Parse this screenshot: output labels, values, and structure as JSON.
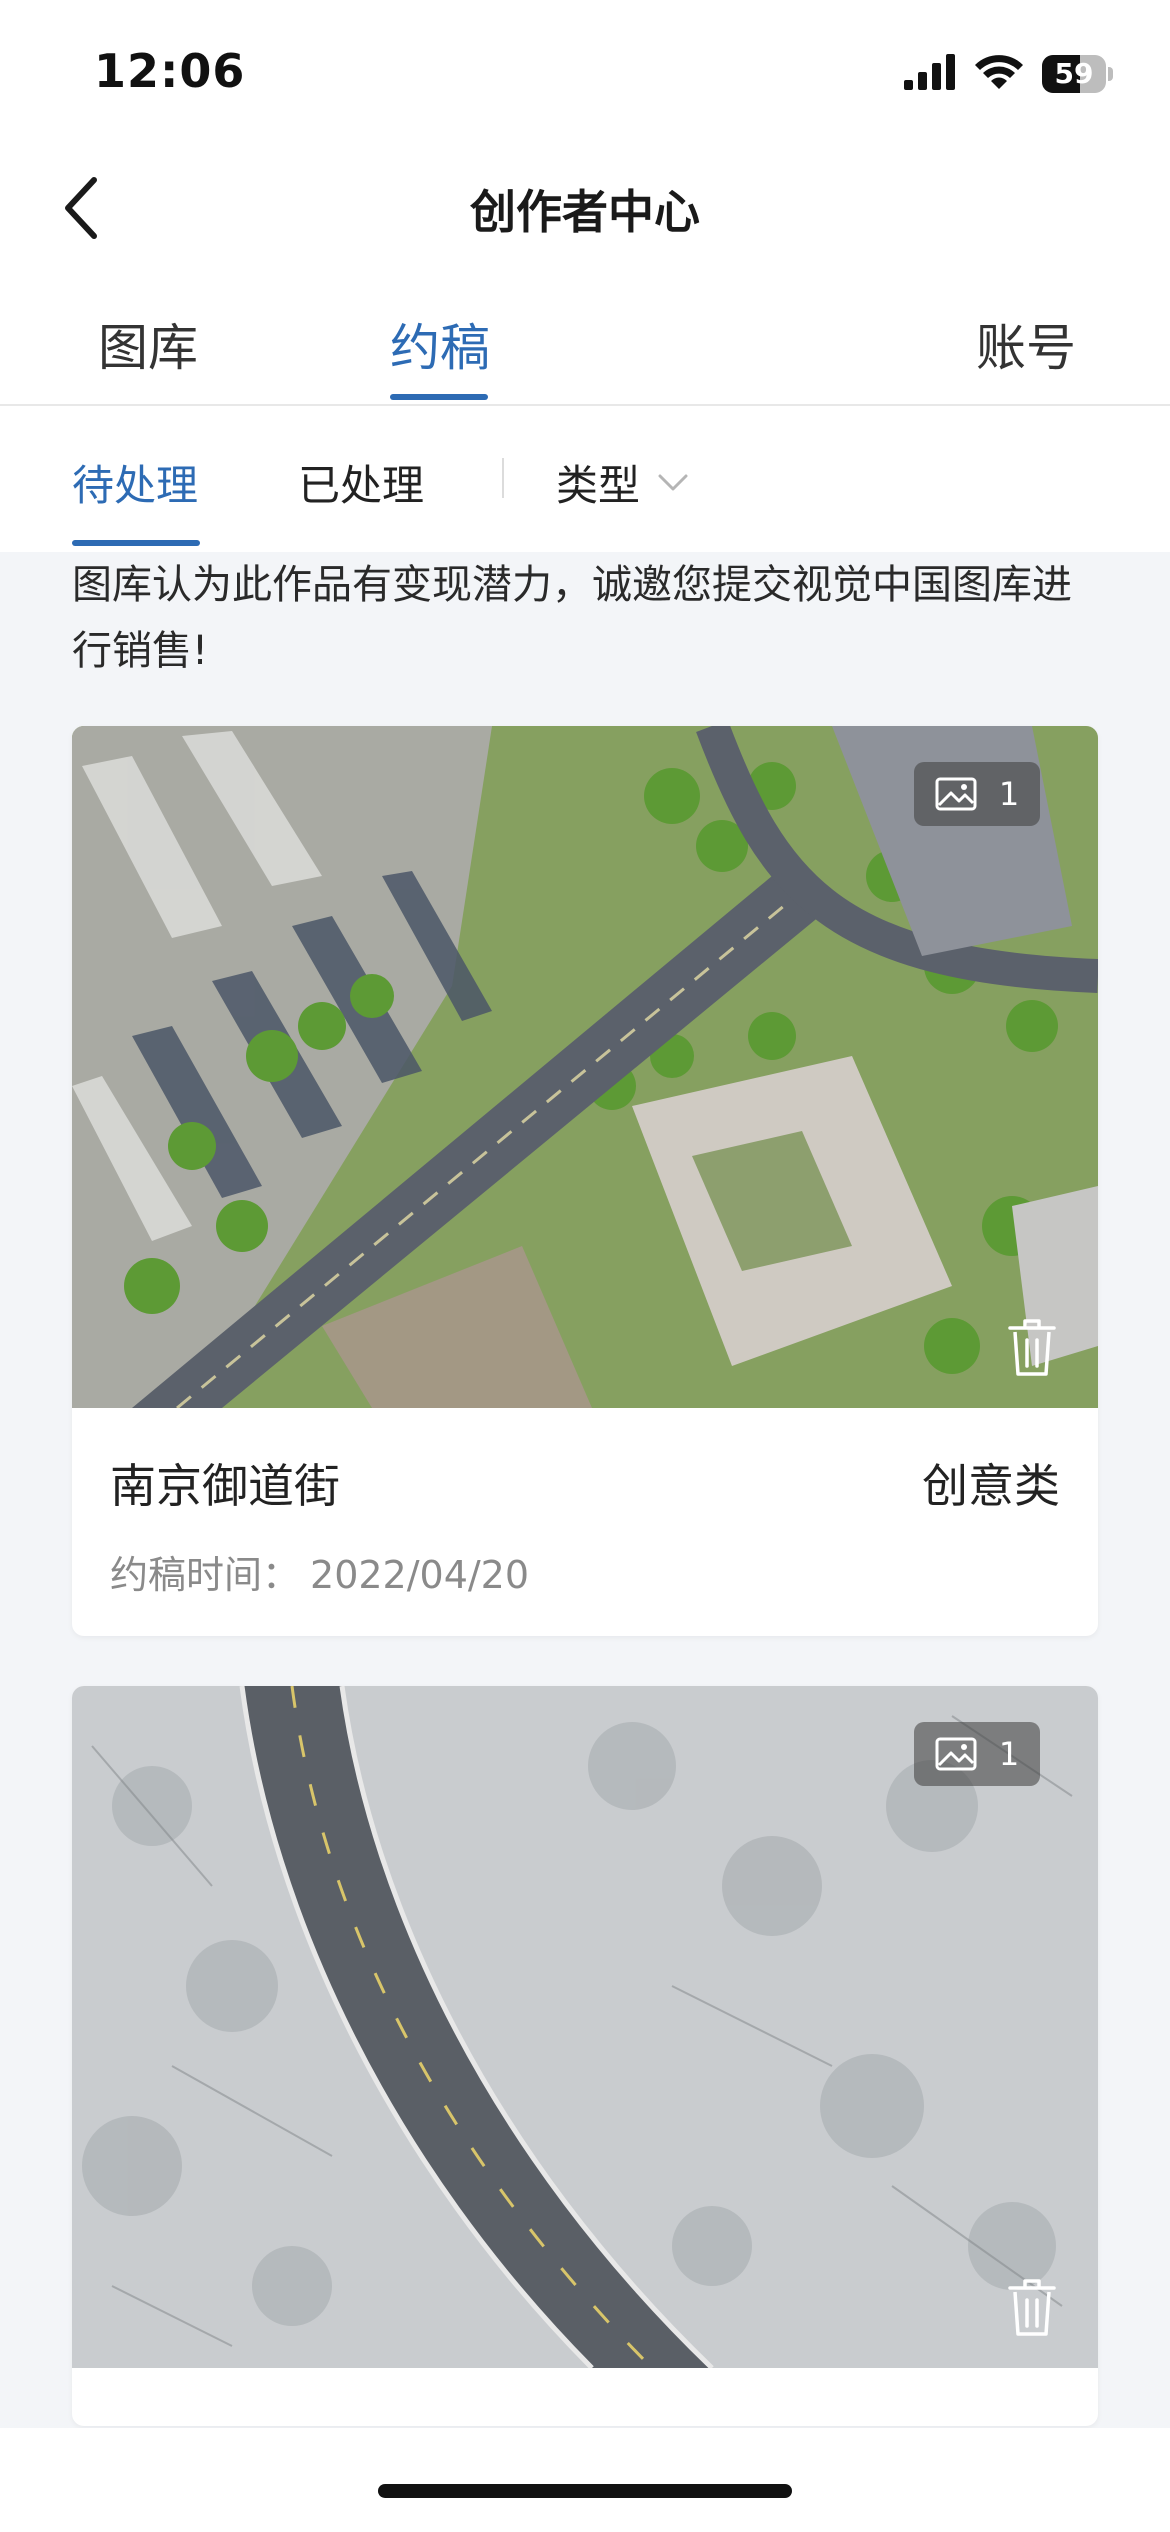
{
  "status_bar": {
    "time": "12:06",
    "battery": "59"
  },
  "nav": {
    "title": "创作者中心"
  },
  "main_tabs": [
    {
      "label": "图库"
    },
    {
      "label": "约稿"
    },
    {
      "label": "账号"
    }
  ],
  "sub_tabs": {
    "pending": "待处理",
    "processed": "已处理",
    "type_filter": "类型"
  },
  "notice": "图库认为此作品有变现潜力，诚邀您提交视觉中国图库进行销售!",
  "cards": [
    {
      "title": "南京御道街",
      "category": "创意类",
      "date_label": "约稿时间：",
      "date": "2022/04/20",
      "image_count": "1"
    },
    {
      "image_count": "1"
    }
  ]
}
